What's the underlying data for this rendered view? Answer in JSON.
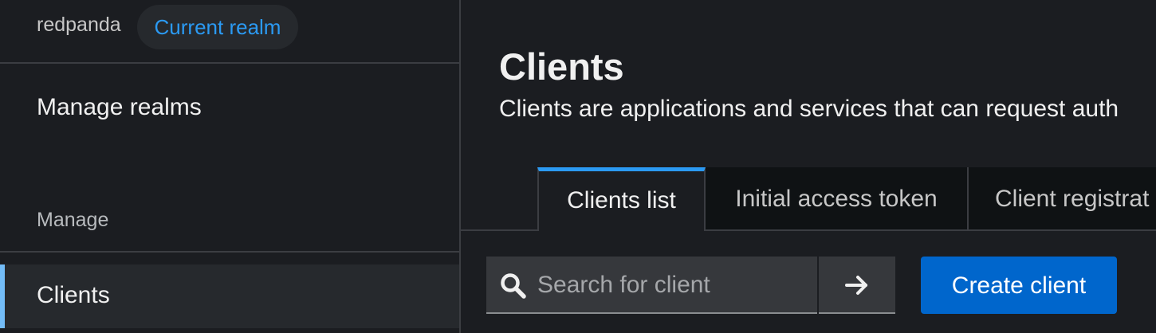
{
  "sidebar": {
    "realm_name": "redpanda",
    "realm_badge": "Current realm",
    "manage_realms": "Manage realms",
    "section_label": "Manage",
    "active_item": "Clients"
  },
  "main": {
    "title": "Clients",
    "description": "Clients are applications and services that can request auth",
    "tabs": [
      {
        "label": "Clients list",
        "active": true
      },
      {
        "label": "Initial access token",
        "active": false
      },
      {
        "label": "Client registrat",
        "active": false
      }
    ],
    "search": {
      "placeholder": "Search for client",
      "value": ""
    },
    "create_button": "Create client"
  },
  "colors": {
    "accent": "#2b9af3",
    "primary_button": "#0066cc",
    "background": "#1b1d21"
  },
  "icons": [
    "search-icon",
    "arrow-right-icon"
  ]
}
